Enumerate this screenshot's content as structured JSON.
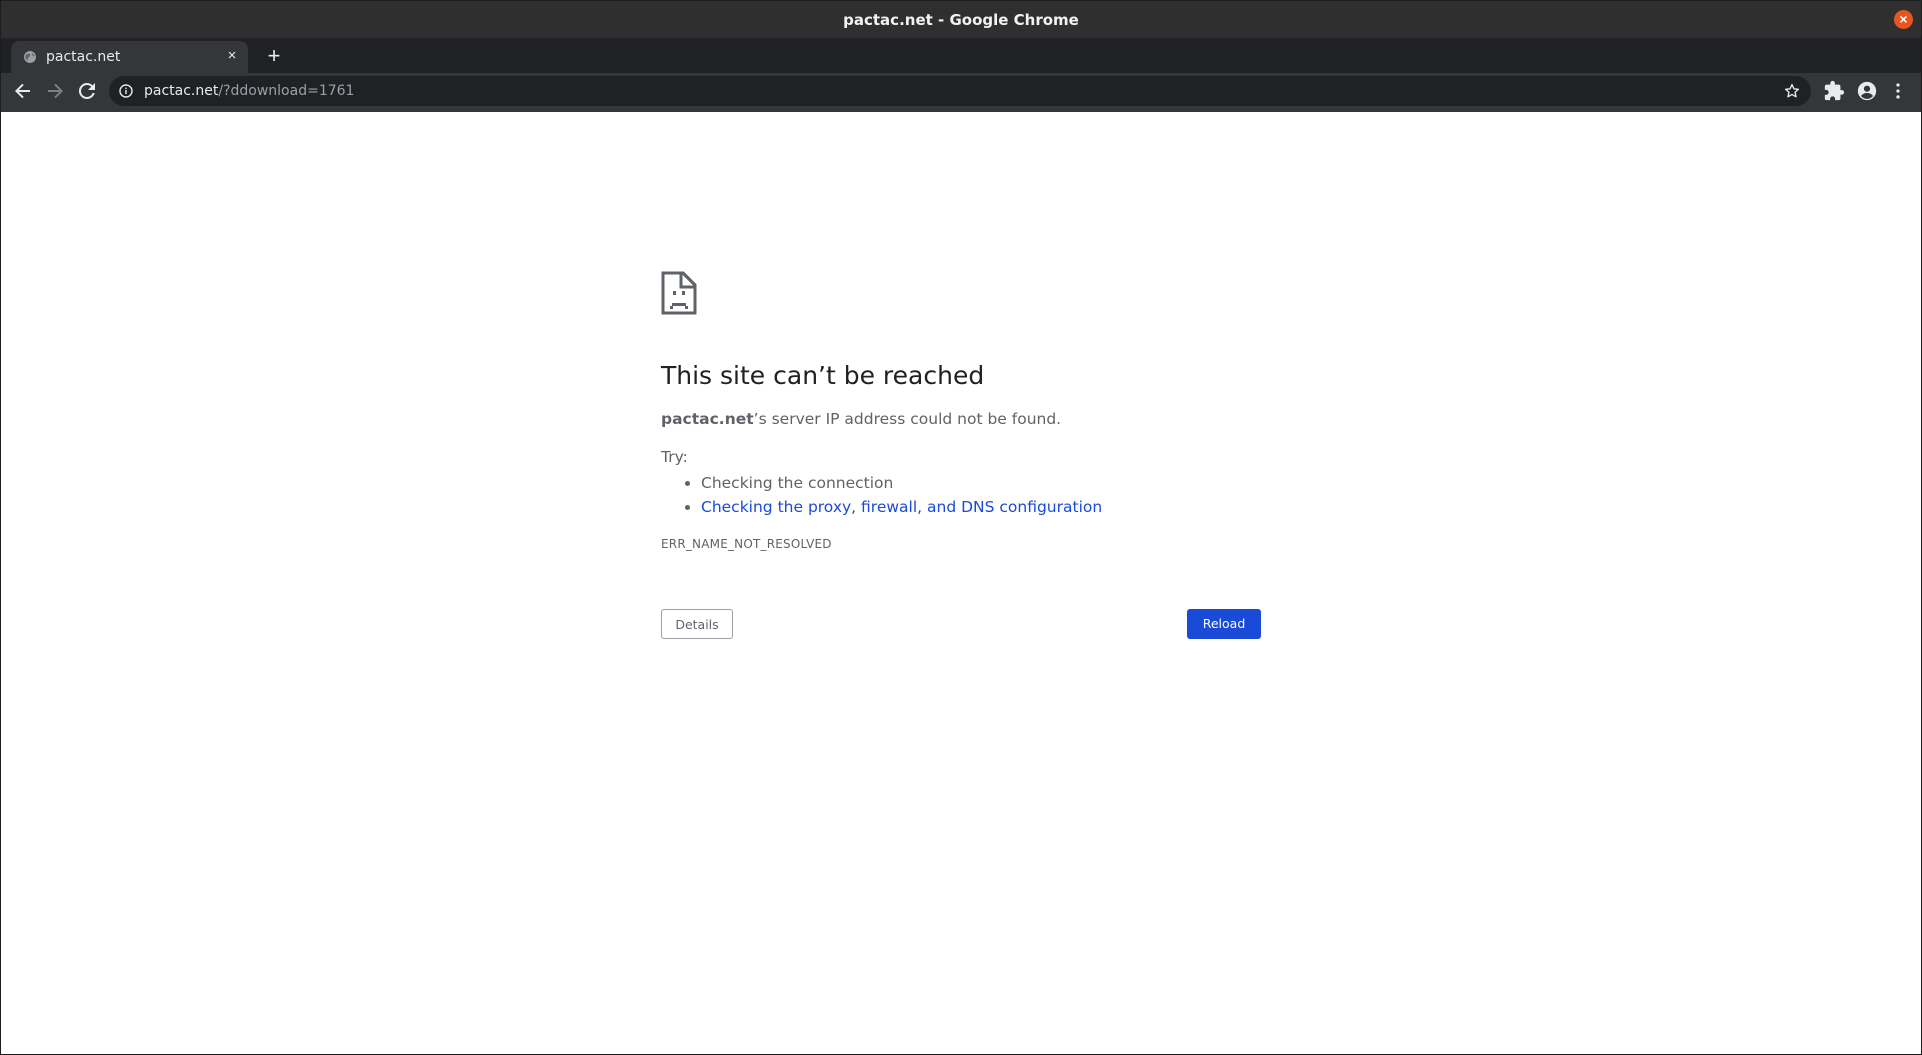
{
  "window": {
    "title": "pactac.net - Google Chrome",
    "close_label": "×"
  },
  "tabs": [
    {
      "label": "pactac.net",
      "close_label": "×"
    }
  ],
  "new_tab_label": "+",
  "omnibox": {
    "host": "pactac.net",
    "path": "/?ddownload=1761"
  },
  "error_page": {
    "heading": "This site can’t be reached",
    "description_host": "pactac.net",
    "description_rest": "’s server IP address could not be found.",
    "try_label": "Try:",
    "suggestions": [
      {
        "text": "Checking the connection",
        "is_link": false
      },
      {
        "text": "Checking the proxy, firewall, and DNS configuration",
        "is_link": true
      }
    ],
    "error_code": "ERR_NAME_NOT_RESOLVED",
    "details_button": "Details",
    "reload_button": "Reload"
  },
  "colors": {
    "titlebar": "#2f2f2f",
    "tabstrip": "#202124",
    "toolbar": "#35363a",
    "link": "#1a4ad8",
    "reload_button": "#1a4ad8",
    "close_button": "#e95420"
  },
  "icons": {
    "tab_favicon": "globe-icon",
    "back": "arrow-left-icon",
    "forward": "arrow-right-icon",
    "reload": "reload-icon",
    "site_info": "info-icon",
    "bookmark": "star-icon",
    "extensions": "puzzle-icon",
    "profile": "account-icon",
    "menu": "kebab-menu-icon",
    "error": "sad-document-icon"
  }
}
